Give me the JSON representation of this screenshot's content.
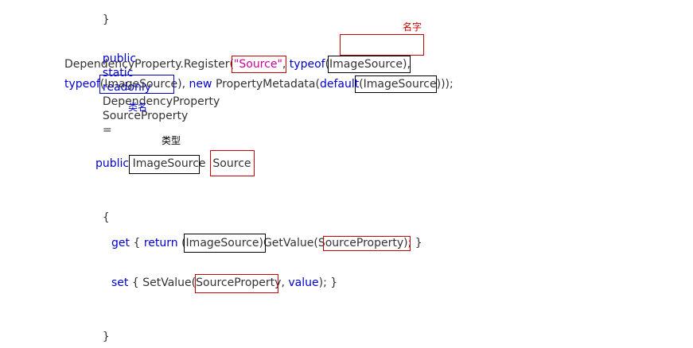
{
  "code": {
    "line1": {
      "brace": "}"
    },
    "line2": {
      "kw_public": "public",
      "kw_static": "static",
      "kw_readonly": "readonly",
      "type": "DependencyProperty",
      "name": "SourceProperty",
      "eq": "="
    },
    "line3": {
      "call": "DependencyProperty.Register(",
      "str": "\"Source\"",
      "comma1": ",",
      "kw_typeof": "typeof",
      "paren_type": "(ImageSource)",
      "comma2": ","
    },
    "line4": {
      "kw_typeof": "typeof",
      "paren_type": "(ImageSource)",
      "comma": ",",
      "kw_new": "new",
      "meta": "PropertyMetadata(",
      "kw_default": "default",
      "tail": "));"
    },
    "line5": {
      "kw_public": "public",
      "type": "ImageSource",
      "name": "Source"
    },
    "line6": {
      "brace": "{"
    },
    "line7": {
      "kw_get": "get",
      "open": "{",
      "kw_return": "return",
      "cast": "(ImageSource)",
      "call": "GetValue(",
      "arg": "SourceProperty",
      "tail": "); }"
    },
    "line8": {
      "kw_set": "set",
      "open": "{ SetValue(",
      "arg": "SourceProperty",
      "comma": ",",
      "kw_value": "value",
      "tail": "); }"
    },
    "line9": {
      "brace": "}"
    }
  },
  "annotations": {
    "name_label": "名字",
    "class_label": "类名",
    "type_label": "类型"
  },
  "colors": {
    "keyword": "#0000cc",
    "string": "#cc0099",
    "text": "#333333",
    "name_box": "#cc0000",
    "type_box": "#000000",
    "class_box": "#0000cc"
  }
}
